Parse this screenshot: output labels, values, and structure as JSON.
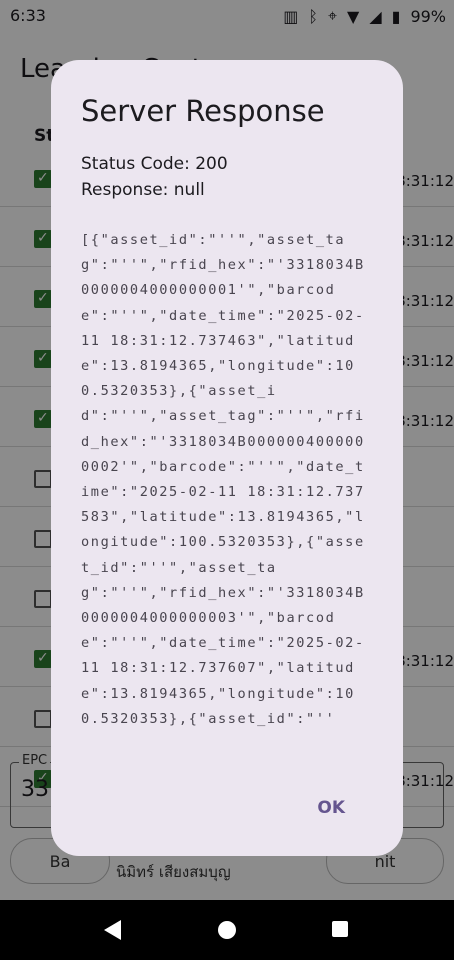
{
  "status_bar": {
    "time": "6:33",
    "battery": "99%"
  },
  "app": {
    "title": "Learning Center",
    "column_headers": [
      "St",
      "o"
    ],
    "rows": [
      {
        "checked": true,
        "time": "18:31:12"
      },
      {
        "checked": true,
        "time": "18:31:12"
      },
      {
        "checked": true,
        "time": "18:31:12"
      },
      {
        "checked": true,
        "time": "18:31:12"
      },
      {
        "checked": true,
        "time": "18:31:12"
      },
      {
        "checked": false,
        "time": ""
      },
      {
        "checked": false,
        "time": ""
      },
      {
        "checked": false,
        "time": ""
      },
      {
        "checked": true,
        "time": "18:31:12"
      },
      {
        "checked": false,
        "time": ""
      },
      {
        "checked": true,
        "time": "18:31:12"
      }
    ],
    "epc_label": "EPC",
    "epc_value": "331",
    "back_label": "Ba",
    "submit_label": "nit",
    "footer_text": "นิมิทร์ เสียงสมบุญ"
  },
  "dialog": {
    "title": "Server Response",
    "status_code": "Status Code: 200",
    "response": "Response: null",
    "body": "[{\"asset_id\":\"''\",\"asset_tag\":\"''\",\"rfid_hex\":\"'3318034B0000004000000001'\",\"barcode\":\"''\",\"date_time\":\"2025-02-11 18:31:12.737463\",\"latitude\":13.8194365,\"longitude\":100.5320353},{\"asset_id\":\"''\",\"asset_tag\":\"''\",\"rfid_hex\":\"'3318034B0000004000000002'\",\"barcode\":\"''\",\"date_time\":\"2025-02-11 18:31:12.737583\",\"latitude\":13.8194365,\"longitude\":100.5320353},{\"asset_id\":\"''\",\"asset_tag\":\"''\",\"rfid_hex\":\"'3318034B0000004000000003'\",\"barcode\":\"''\",\"date_time\":\"2025-02-11 18:31:12.737607\",\"latitude\":13.8194365,\"longitude\":100.5320353},{\"asset_id\":\"''",
    "ok_label": "OK"
  }
}
